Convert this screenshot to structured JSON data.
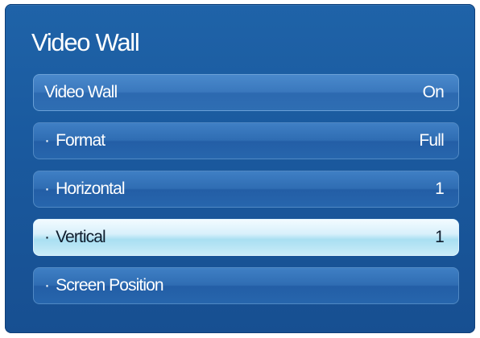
{
  "panel": {
    "title": "Video Wall"
  },
  "menu": {
    "items": [
      {
        "label": "Video Wall",
        "value": "On",
        "bullet": ""
      },
      {
        "label": "Format",
        "value": "Full",
        "bullet": "·"
      },
      {
        "label": "Horizontal",
        "value": "1",
        "bullet": "·"
      },
      {
        "label": "Vertical",
        "value": "1",
        "bullet": "·"
      },
      {
        "label": "Screen Position",
        "value": "",
        "bullet": "·"
      }
    ],
    "selected_label": "Vertical"
  },
  "colors": {
    "panel_blue": "#1a5a9f",
    "item_blue": "#2f6db3",
    "selected_highlight": "#a9dff2",
    "text_light": "#ffffff",
    "text_dark": "#0f1c2c"
  }
}
